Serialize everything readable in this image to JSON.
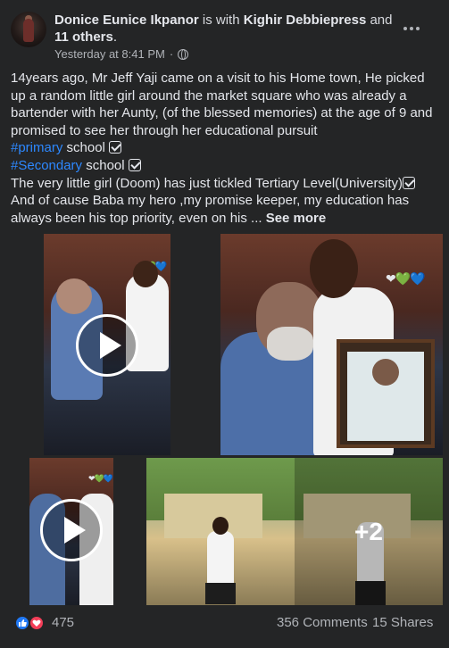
{
  "header": {
    "author": "Donice Eunice Ikpanor",
    "with_text": "is with",
    "tagged_person": "Kighir Debbiepress",
    "and_text": "and",
    "others": "11 others",
    "period": ".",
    "timestamp": "Yesterday at 8:41 PM",
    "dot_separator": "·"
  },
  "post": {
    "paragraph1": "14years ago, Mr Jeff Yaji  came on a visit to his Home town, He picked up a random little girl around the market square who was already a bartender with her Aunty, (of the blessed memories) at the age of 9 and promised to see her through her educational pursuit",
    "hashtag1": "#primary",
    "line1_rest": " school ",
    "hashtag2": "#Secondary",
    "line2_rest": " school ",
    "line3": "The very little girl (Doom) has just tickled Tertiary Level(University)",
    "line4": "And of cause Baba my hero ,my promise keeper, my education has always been his top priority, even on his ... ",
    "see_more": "See more"
  },
  "media": {
    "more_count": "+2",
    "hearts": "❤💚💙"
  },
  "footer": {
    "reaction_count": "475",
    "comments": "356 Comments",
    "shares": "15 Shares"
  },
  "colors": {
    "background": "#242526",
    "hashtag": "#2d88ff",
    "like_blue": "#2078f4",
    "love_red": "#f33e58"
  },
  "icons": [
    "globe-icon",
    "more-options-icon",
    "check-icon",
    "play-icon",
    "like-icon",
    "love-icon"
  ]
}
